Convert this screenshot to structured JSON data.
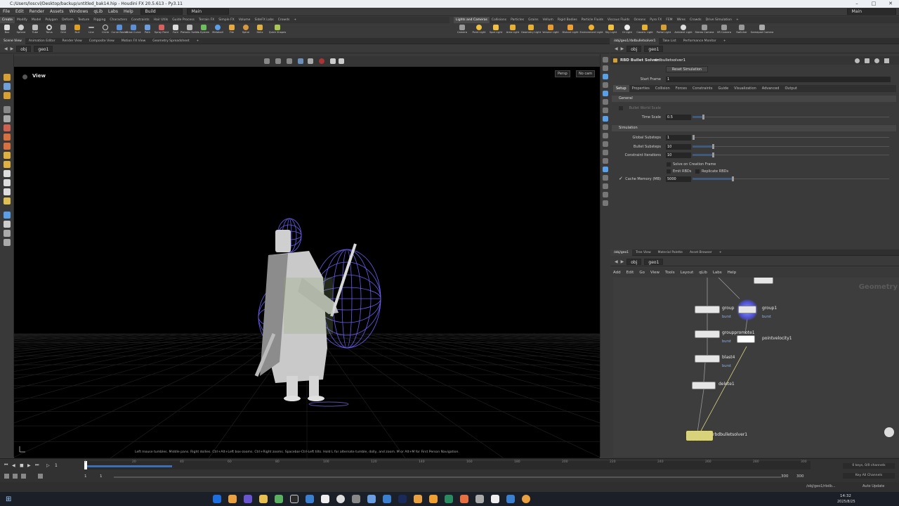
{
  "window": {
    "title": "C:/Users/loscvl/Desktop/backup/untitled_bak14.hip - Houdini FX 20.5.613 - Py3.11"
  },
  "menu": {
    "items": [
      "File",
      "Edit",
      "Render",
      "Assets",
      "Windows",
      "qLib",
      "Labs",
      "Help"
    ],
    "desktop": "Build",
    "desk_label": "Main",
    "right_label": "Main"
  },
  "shelf_tabs_left": [
    "Create",
    "Modify",
    "Model",
    "Polygon",
    "Deform",
    "Texture",
    "Rigging",
    "Characters",
    "Constraints",
    "Hair Utils",
    "Guide Process",
    "Terrain FX",
    "Simple FX",
    "Volume",
    "SideFX Labs",
    "Crowds"
  ],
  "shelf_tabs_right": [
    "Lights and Cameras",
    "Collisions",
    "Particles",
    "Grains",
    "Vellum",
    "Rigid Bodies",
    "Particle Fluids",
    "Viscous Fluids",
    "Oceans",
    "Pyro FX",
    "FEM",
    "Wires",
    "Crowds",
    "Drive Simulation"
  ],
  "shelf_tools_left": [
    "Box",
    "Sphere",
    "Tube",
    "Torus",
    "Grid",
    "Null",
    "Line",
    "Circle",
    "Curve Bezier",
    "Draw Curve",
    "Path",
    "Spray Paint",
    "Font",
    "Platonic Solids",
    "L-System",
    "Metaball",
    "File",
    "Spiral",
    "Helix",
    "Quick Shapes"
  ],
  "shelf_tools_right": [
    "Camera",
    "Point Light",
    "Spot Light",
    "Area Light",
    "Geometry Light",
    "Volume Light",
    "Distant Light",
    "Environment Light",
    "Sky Light",
    "GI Light",
    "Caustic Light",
    "Portal Light",
    "Ambient Light",
    "Stereo Camera",
    "VR Camera",
    "Switcher",
    "Gamepad Camera"
  ],
  "left_pane_tabs": [
    "Scene View",
    "Animation Editor",
    "Render View",
    "Composite View",
    "Motion FX View",
    "Geometry Spreadsheet"
  ],
  "right_top_tabs": [
    "/obj/geo1/rbdbulletsolver1",
    "Take List",
    "Performance Monitor"
  ],
  "path_left": {
    "root": "obj",
    "node": "geo1"
  },
  "path_right": {
    "root": "obj",
    "node": "geo1"
  },
  "viewport": {
    "label": "View",
    "persp": "Persp",
    "cam": "No cam",
    "help": "Left mouse tumbles. Middle pans. Right dollies. Ctrl+Alt+Left box-zooms. Ctrl+Right zooms. Spacebar-Ctrl-Left tilts. Hold L for alternate tumble, dolly, and zoom. M or Alt+M for First Person Navigation."
  },
  "params": {
    "node_type": "RBD Bullet Solver",
    "node_name": "rbdbulletsolver1",
    "reset_label": "Reset Simulation",
    "start_frame_label": "Start Frame",
    "start_frame": "1",
    "tabs": [
      "Setup",
      "Properties",
      "Collision",
      "Forces",
      "Constraints",
      "Guide",
      "Visualization",
      "Advanced",
      "Output"
    ],
    "section_general": "General",
    "bullet_world_scale": "Bullet World Scale",
    "time_scale_label": "Time Scale",
    "time_scale": "0.5",
    "section_sim": "Simulation",
    "global_substeps_label": "Global Substeps",
    "global_substeps": "1",
    "bullet_substeps_label": "Bullet Substeps",
    "bullet_substeps": "10",
    "constraint_iter_label": "Constraint Iterations",
    "constraint_iter": "10",
    "solve_creation": "Solve on Creation Frame",
    "emit_rbds": "Emit RBDs",
    "replicate_rbds": "Replicate RBDs",
    "cache_memory_label": "Cache Memory (MB)",
    "cache_memory": "5000"
  },
  "sliders": {
    "time_scale": 0.05,
    "global_substeps": 0.0,
    "bullet_substeps": 0.1,
    "constraint_iter": 0.1,
    "cache_memory": 0.2
  },
  "net_tabs": [
    "/obj/geo1",
    "Tree View",
    "Material Palette",
    "Asset Browser"
  ],
  "net_menu": [
    "Add",
    "Edit",
    "Go",
    "View",
    "Tools",
    "Layout",
    "qLib",
    "Labs",
    "Help"
  ],
  "net_context": "Geometry",
  "nodes": [
    {
      "name": "group",
      "sub": "burst"
    },
    {
      "name": "group1",
      "sub": "burst"
    },
    {
      "name": "grouppromote1",
      "sub": "burst"
    },
    {
      "name": "pointvelocity1",
      "sub": ""
    },
    {
      "name": "blast4",
      "sub": "burst"
    },
    {
      "name": "delete1",
      "sub": ""
    },
    {
      "name": "rbdbulletsolver1",
      "sub": ""
    }
  ],
  "timeline": {
    "frame": "1",
    "start": "1",
    "start2": "1",
    "end": "300",
    "end2": "300",
    "ticks": [
      "1",
      "20",
      "40",
      "60",
      "80",
      "100",
      "120",
      "140",
      "160",
      "180",
      "200",
      "220",
      "240",
      "260",
      "280",
      "300"
    ],
    "keys": "0 keys, 0/0 channels",
    "key_all": "Key All Channels",
    "auto_update": "Auto Update",
    "path": "/obj/geo1/rbdb..."
  },
  "taskbar": {
    "time": "14:32",
    "date": "2025/8/25"
  },
  "colors": {
    "accent": "#f0b400",
    "wire": "#7d6bff",
    "select": "#4d6fb3"
  }
}
